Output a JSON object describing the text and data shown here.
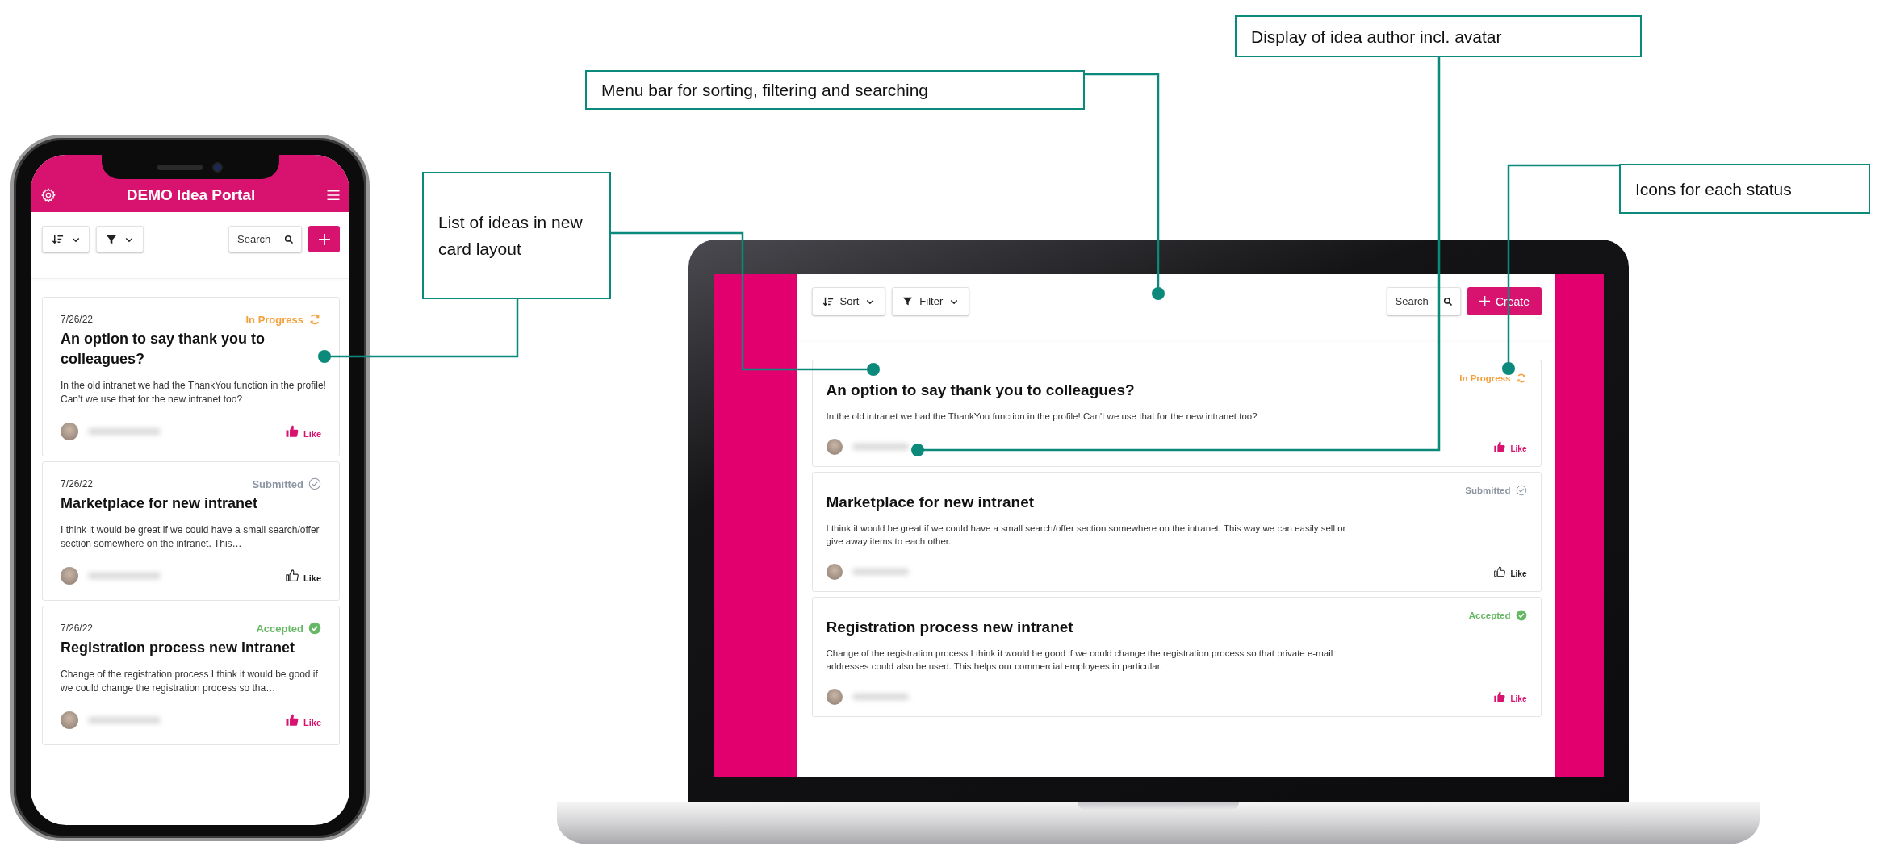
{
  "callouts": [
    {
      "text": "Menu bar for sorting, filtering and searching"
    },
    {
      "text": "Display of idea author incl. avatar"
    },
    {
      "text": "Icons for each status"
    },
    {
      "text": "List of ideas in new card layout"
    }
  ],
  "phone": {
    "title": "DEMO Idea Portal",
    "search": {
      "placeholder": "Search"
    },
    "ideas": [
      {
        "date": "7/26/22",
        "status": "In Progress",
        "kind": "in_progress",
        "title": "An option to say thank you to colleagues?",
        "body": "In the old intranet we had the ThankYou function in the profile! Can't we use that for the new intranet too?",
        "like": "Like",
        "liked": true
      },
      {
        "date": "7/26/22",
        "status": "Submitted",
        "kind": "submitted",
        "title": "Marketplace for new intranet",
        "body": "I think it would be great if we could have a small search/offer section somewhere on the intranet. This…",
        "like": "Like",
        "liked": false
      },
      {
        "date": "7/26/22",
        "status": "Accepted",
        "kind": "accepted",
        "title": "Registration process new intranet",
        "body": "Change of the registration process I think it would be good if we could change the registration process so tha…",
        "like": "Like",
        "liked": true
      }
    ]
  },
  "laptop": {
    "sort": "Sort",
    "filter": "Filter",
    "search": {
      "placeholder": "Search"
    },
    "create": "Create",
    "ideas": [
      {
        "status": "In Progress",
        "kind": "in_progress",
        "title": "An option to say thank you to colleagues?",
        "body": "In the old intranet we had the ThankYou function in the profile! Can't we use that for the new intranet too?",
        "like": "Like",
        "liked": true
      },
      {
        "status": "Submitted",
        "kind": "submitted",
        "title": "Marketplace for new intranet",
        "body": "I think it would be great if we could have a small search/offer section somewhere on the intranet. This way we can easily sell or give away items to each other.",
        "like": "Like",
        "liked": false
      },
      {
        "status": "Accepted",
        "kind": "accepted",
        "title": "Registration process new intranet",
        "body": "Change of the registration process I think it would be good if we could change the registration process so that private e-mail addresses could also be used. This helps our commercial employees in particular.",
        "like": "Like",
        "liked": true
      }
    ]
  }
}
